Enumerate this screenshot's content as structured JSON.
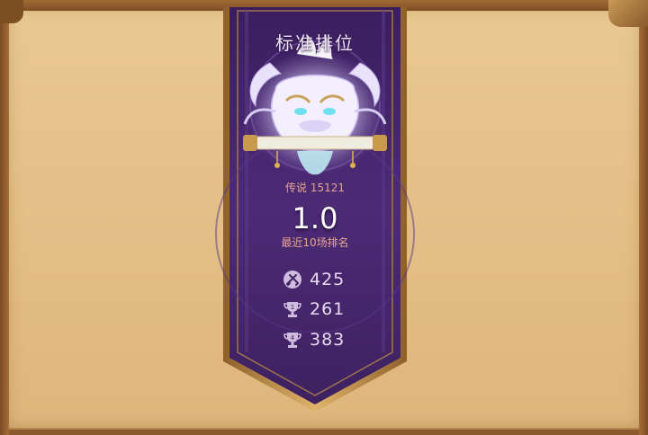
{
  "panel": {
    "title": "标准排位",
    "tier_label": "传说 15121",
    "rank_value": "1.0",
    "rank_caption": "最近10场排名"
  },
  "stats": [
    {
      "icon": "crossed-swords-icon",
      "value": "425"
    },
    {
      "icon": "trophy-1-icon",
      "value": "261"
    },
    {
      "icon": "trophy-4-icon",
      "value": "383"
    }
  ],
  "colors": {
    "banner_purple": "#4a2a72",
    "banner_gold": "#c8964e",
    "parchment": "#e6c38a",
    "accent_text": "#e7a38f"
  }
}
